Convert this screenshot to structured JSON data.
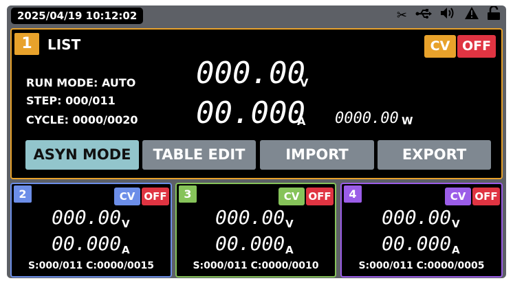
{
  "status_bar": {
    "datetime": "2025/04/19 10:12:02",
    "icons": [
      "scissors-icon",
      "usb-icon",
      "speaker-icon",
      "warning-icon",
      "unlock-icon"
    ]
  },
  "main_channel": {
    "number": "1",
    "mode": "LIST",
    "cv_label": "CV",
    "off_label": "OFF",
    "run_mode": "RUN MODE: AUTO",
    "step": "STEP: 000/011",
    "cycle": "CYCLE: 0000/0020",
    "voltage": "000.00",
    "voltage_unit": "V",
    "current": "00.000",
    "current_unit": "A",
    "power": "0000.00",
    "power_unit": "W",
    "buttons": [
      "ASYN MODE",
      "TABLE EDIT",
      "IMPORT",
      "EXPORT"
    ]
  },
  "sub_channels": [
    {
      "number": "2",
      "cv_label": "CV",
      "off_label": "OFF",
      "voltage": "000.00",
      "voltage_unit": "V",
      "current": "00.000",
      "current_unit": "A",
      "footer": "S:000/011 C:0000/0015"
    },
    {
      "number": "3",
      "cv_label": "CV",
      "off_label": "OFF",
      "voltage": "000.00",
      "voltage_unit": "V",
      "current": "00.000",
      "current_unit": "A",
      "footer": "S:000/011 C:0000/0010"
    },
    {
      "number": "4",
      "cv_label": "CV",
      "off_label": "OFF",
      "voltage": "000.00",
      "voltage_unit": "V",
      "current": "00.000",
      "current_unit": "A",
      "footer": "S:000/011 C:0000/0005"
    }
  ],
  "colors": {
    "channel1": "#e8a22b",
    "channel2": "#6c8ee8",
    "channel3": "#86c35a",
    "channel4": "#9b5de8",
    "off_red": "#e03442",
    "button_active": "#92c5cc",
    "button_inactive": "#7f8891"
  }
}
